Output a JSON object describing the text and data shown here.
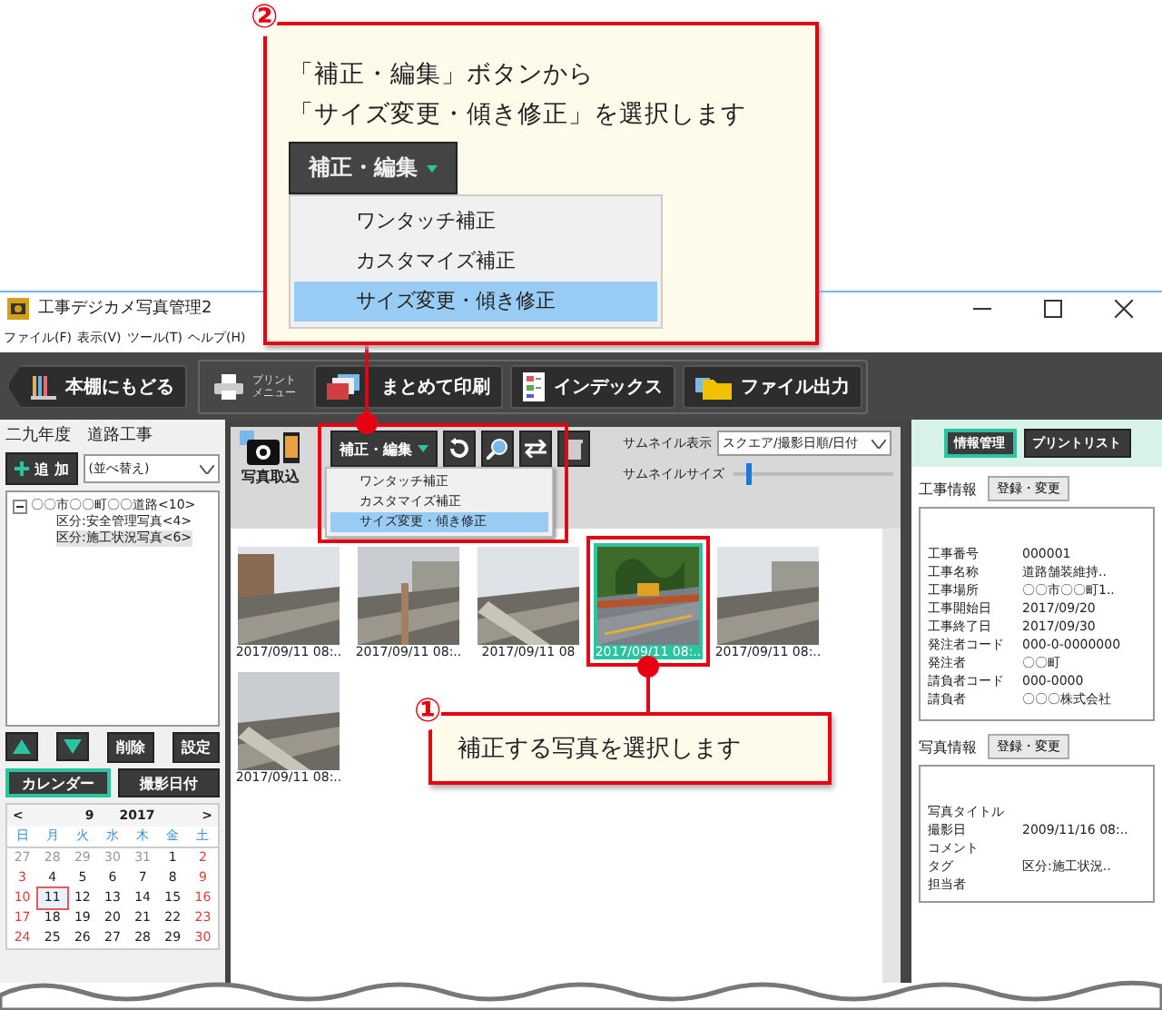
{
  "callout_2": {
    "number": "②",
    "lines": [
      "「補正・編集」ボタンから",
      "「サイズ変更・傾き修正」を選択します"
    ],
    "button": "補正・編集",
    "menu": [
      {
        "label": "ワンタッチ補正",
        "selected": false
      },
      {
        "label": "カスタマイズ補正",
        "selected": false
      },
      {
        "label": "サイズ変更・傾き修正",
        "selected": true
      }
    ]
  },
  "callout_1": {
    "number": "①",
    "text": "補正する写真を選択します"
  },
  "window": {
    "title": "工事デジカメ写真管理2",
    "menu": [
      "ファイル(F)",
      "表示(V)",
      "ツール(T)",
      "ヘルプ(H)"
    ]
  },
  "toolbar": {
    "back": "本棚にもどる",
    "print_menu": [
      "プリント",
      "メニュー"
    ],
    "buttons": [
      "まとめて印刷",
      "インデックス",
      "ファイル出力"
    ]
  },
  "left_panel": {
    "title": "二九年度　道路工事",
    "add": "追 加",
    "sort": "(並べ替え)",
    "tree": [
      {
        "label": "〇〇市〇〇町〇〇道路<10>",
        "expanded": true,
        "selected": false,
        "children": [
          {
            "label": "区分:安全管理写真<4>",
            "selected": false
          },
          {
            "label": "区分:施工状況写真<6>",
            "selected": true
          }
        ]
      }
    ],
    "buttons": [
      "削除",
      "設定"
    ],
    "tabs": [
      {
        "label": "カレンダー",
        "selected": true
      },
      {
        "label": "撮影日付",
        "selected": false
      }
    ],
    "calendar": {
      "prev": "<",
      "month": "9",
      "year": "2017",
      "next": ">",
      "weekdays": [
        "日",
        "月",
        "火",
        "水",
        "木",
        "金",
        "土"
      ],
      "weeks": [
        [
          {
            "day": "27",
            "muted": true,
            "selected": false
          },
          {
            "day": "28",
            "muted": true,
            "selected": false
          },
          {
            "day": "29",
            "muted": true,
            "selected": false
          },
          {
            "day": "30",
            "muted": true,
            "selected": false
          },
          {
            "day": "31",
            "muted": true,
            "selected": false
          },
          {
            "day": "1",
            "muted": false,
            "selected": false
          },
          {
            "day": "2",
            "muted": false,
            "selected": false
          }
        ],
        [
          {
            "day": "3",
            "muted": false,
            "selected": false
          },
          {
            "day": "4",
            "muted": false,
            "selected": false
          },
          {
            "day": "5",
            "muted": false,
            "selected": false
          },
          {
            "day": "6",
            "muted": false,
            "selected": false
          },
          {
            "day": "7",
            "muted": false,
            "selected": false
          },
          {
            "day": "8",
            "muted": false,
            "selected": false
          },
          {
            "day": "9",
            "muted": false,
            "selected": false
          }
        ],
        [
          {
            "day": "10",
            "muted": false,
            "selected": false
          },
          {
            "day": "11",
            "muted": false,
            "selected": true
          },
          {
            "day": "12",
            "muted": false,
            "selected": false
          },
          {
            "day": "13",
            "muted": false,
            "selected": false
          },
          {
            "day": "14",
            "muted": false,
            "selected": false
          },
          {
            "day": "15",
            "muted": false,
            "selected": false
          },
          {
            "day": "16",
            "muted": false,
            "selected": false
          }
        ],
        [
          {
            "day": "17",
            "muted": false,
            "selected": false
          },
          {
            "day": "18",
            "muted": false,
            "selected": false
          },
          {
            "day": "19",
            "muted": false,
            "selected": false
          },
          {
            "day": "20",
            "muted": false,
            "selected": false
          },
          {
            "day": "21",
            "muted": false,
            "selected": false
          },
          {
            "day": "22",
            "muted": false,
            "selected": false
          },
          {
            "day": "23",
            "muted": false,
            "selected": false
          }
        ],
        [
          {
            "day": "24",
            "muted": false,
            "selected": false
          },
          {
            "day": "25",
            "muted": false,
            "selected": false
          },
          {
            "day": "26",
            "muted": false,
            "selected": false
          },
          {
            "day": "27",
            "muted": false,
            "selected": false
          },
          {
            "day": "28",
            "muted": false,
            "selected": false
          },
          {
            "day": "29",
            "muted": false,
            "selected": false
          },
          {
            "day": "30",
            "muted": false,
            "selected": false
          }
        ]
      ]
    }
  },
  "center": {
    "import": "写真取込",
    "edit_button": "補正・編集",
    "edit_menu": [
      {
        "label": "ワンタッチ補正",
        "selected": false
      },
      {
        "label": "カスタマイズ補正",
        "selected": false
      },
      {
        "label": "サイズ変更・傾き修正",
        "selected": true
      }
    ],
    "display_label": "サムネイル表示",
    "display_value": "スクエア/撮影日順/日付",
    "size_label": "サムネイルサイズ",
    "size": {
      "level": 0.08
    },
    "photos": [
      {
        "kind": "picture",
        "caption": "2017/09/11 08:..",
        "selected": false
      },
      {
        "kind": "picture",
        "caption": "2017/09/11 08:..",
        "selected": false
      },
      {
        "kind": "picture",
        "caption": "2017/09/11 08",
        "selected": false
      },
      {
        "kind": "picture",
        "caption": "2017/09/11 08:..",
        "selected": true
      },
      {
        "kind": "picture",
        "caption": "2017/09/11 08:..",
        "selected": false
      },
      {
        "kind": "picture",
        "caption": "2017/09/11 08:..",
        "selected": false
      }
    ]
  },
  "right_panel": {
    "tabs": [
      {
        "label": "情報管理",
        "selected": true
      },
      {
        "label": "プリントリスト",
        "selected": false
      }
    ],
    "sections": [
      {
        "title": "工事情報",
        "button": "登録・変更",
        "rows": [
          {
            "key": "工事番号",
            "value": "000001"
          },
          {
            "key": "工事名称",
            "value": "道路舗装維持.."
          },
          {
            "key": "工事場所",
            "value": "〇〇市〇〇町1.."
          },
          {
            "key": "工事開始日",
            "value": "2017/09/20"
          },
          {
            "key": "工事終了日",
            "value": "2017/09/30"
          },
          {
            "key": "発注者コード",
            "value": "000-0-0000000"
          },
          {
            "key": "発注者",
            "value": "〇〇町"
          },
          {
            "key": "請負者コード",
            "value": "000-0000"
          },
          {
            "key": "請負者",
            "value": "〇〇〇株式会社"
          }
        ]
      },
      {
        "title": "写真情報",
        "button": "登録・変更",
        "rows": [
          {
            "key": "写真タイトル"
          },
          {
            "key": "撮影日",
            "value": "2009/11/16 08:.."
          },
          {
            "key": "コメント"
          },
          {
            "key": "タグ",
            "value": "区分:施工状況.."
          },
          {
            "key": "担当者"
          }
        ]
      }
    ]
  }
}
